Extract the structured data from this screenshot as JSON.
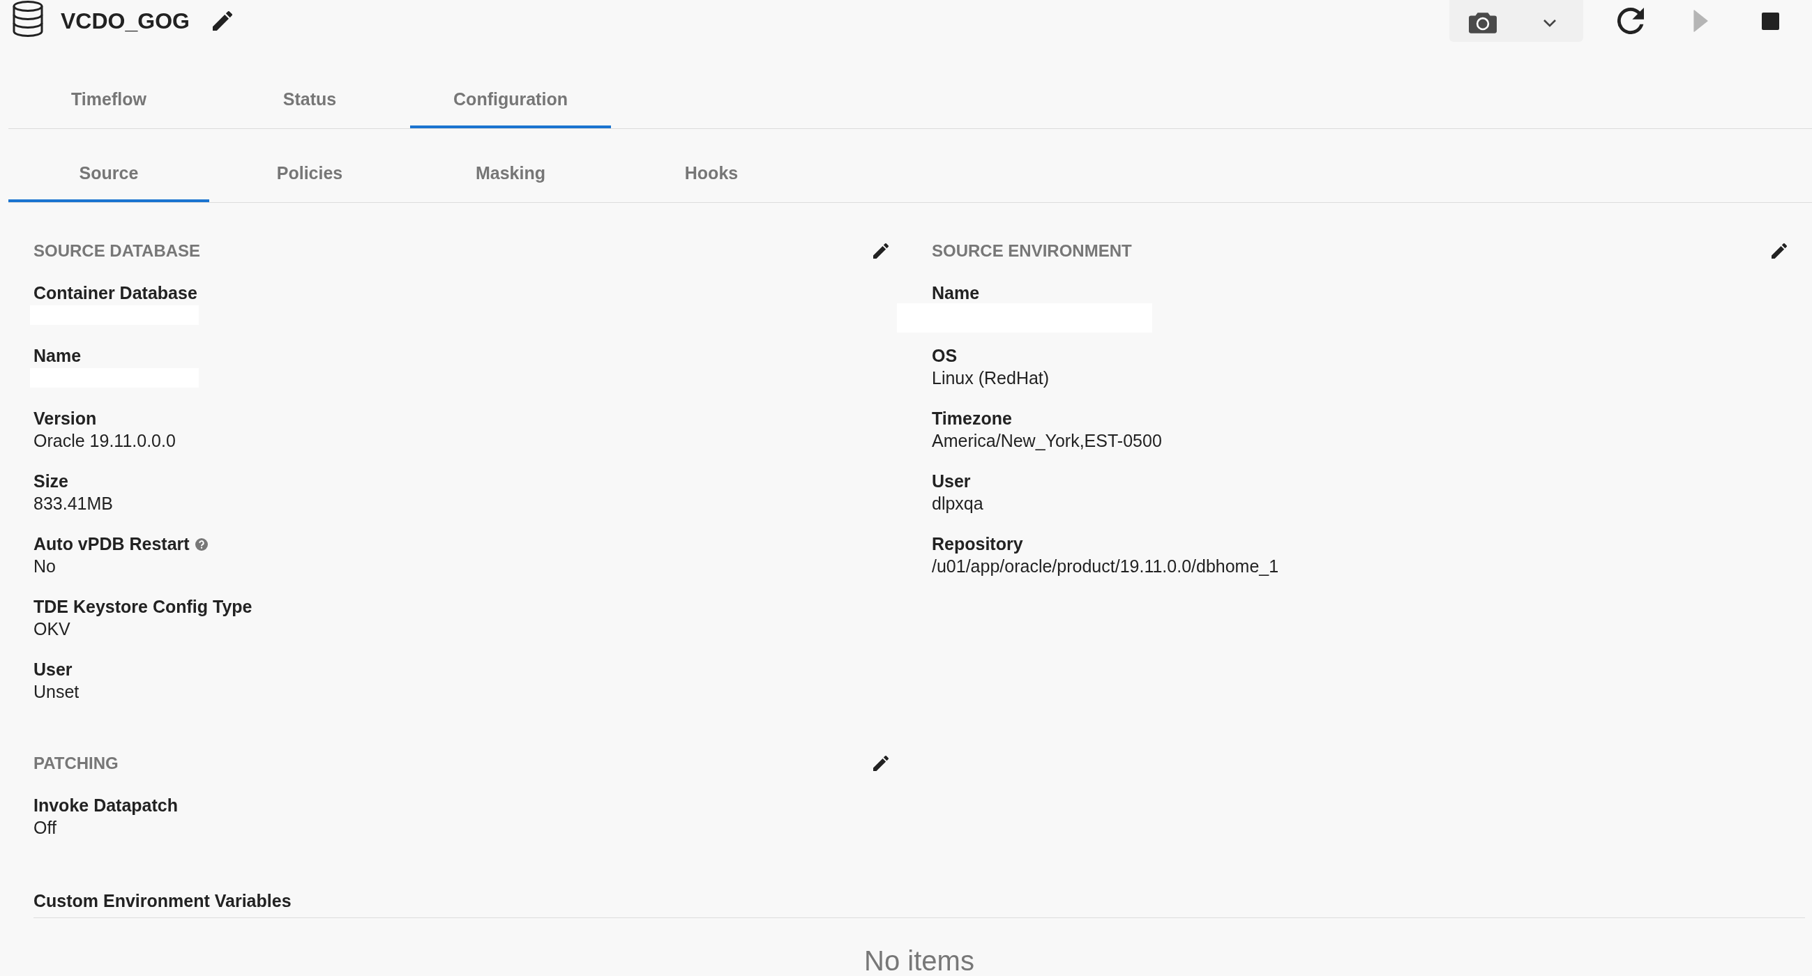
{
  "header": {
    "title": "VCDO_GOG"
  },
  "toolbar": [
    {
      "kind": "snapshot",
      "disabled": false
    },
    {
      "kind": "refresh",
      "disabled": false
    },
    {
      "kind": "start",
      "disabled": true
    },
    {
      "kind": "stop",
      "disabled": false
    }
  ],
  "tabs": [
    {
      "label": "Timeflow",
      "selected": false
    },
    {
      "label": "Status",
      "selected": false
    },
    {
      "label": "Configuration",
      "selected": true
    }
  ],
  "subtabs": [
    {
      "label": "Source",
      "selected": true
    },
    {
      "label": "Policies",
      "selected": false
    },
    {
      "label": "Masking",
      "selected": false
    },
    {
      "label": "Hooks",
      "selected": false
    }
  ],
  "source_database": {
    "title": "SOURCE DATABASE",
    "editable": true,
    "fields": [
      {
        "label": "Container Database",
        "help": false,
        "redacted": true
      },
      {
        "label": "Name",
        "help": false,
        "redacted": true
      },
      {
        "label": "Version",
        "help": false,
        "redacted": false,
        "value": "Oracle 19.11.0.0.0"
      },
      {
        "label": "Size",
        "help": false,
        "redacted": false,
        "value": "833.41MB"
      },
      {
        "label": "Auto vPDB Restart",
        "help": true,
        "redacted": false,
        "value": "No"
      },
      {
        "label": "TDE Keystore Config Type",
        "help": false,
        "redacted": false,
        "value": "OKV"
      },
      {
        "label": "User",
        "help": false,
        "redacted": false,
        "value": "Unset"
      }
    ]
  },
  "source_environment": {
    "title": "SOURCE ENVIRONMENT",
    "editable": true,
    "fields": [
      {
        "label": "Name",
        "help": false,
        "redacted": true
      },
      {
        "label": "OS",
        "help": false,
        "redacted": false,
        "value": "Linux (RedHat)"
      },
      {
        "label": "Timezone",
        "help": false,
        "redacted": false,
        "value": "America/New_York,EST-0500"
      },
      {
        "label": "User",
        "help": false,
        "redacted": false,
        "value": "dlpxqa"
      },
      {
        "label": "Repository",
        "help": false,
        "redacted": false,
        "value": "/u01/app/oracle/product/19.11.0.0/dbhome_1"
      }
    ]
  },
  "patching": {
    "title": "PATCHING",
    "editable": true,
    "fields": [
      {
        "label": "Invoke Datapatch",
        "help": false,
        "redacted": false,
        "value": "Off"
      }
    ]
  },
  "custom_environment_variables": {
    "title": "Custom Environment Variables",
    "empty_text": "No items"
  }
}
